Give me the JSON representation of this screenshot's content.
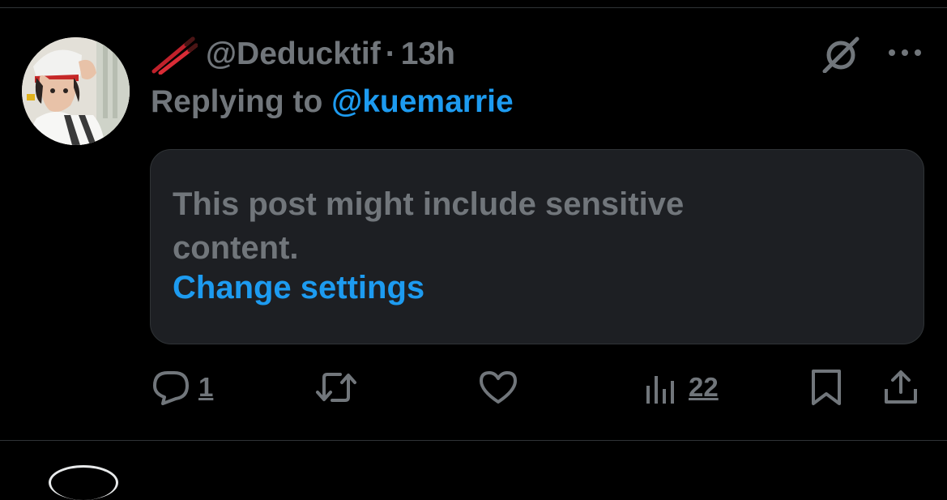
{
  "tweet": {
    "handle": "@Deducktif",
    "separator": "·",
    "time": "13h",
    "replying_prefix": "Replying to ",
    "replying_to": "@kuemarrie",
    "sensitive_notice": "This post might include sensitive content.",
    "change_settings_label": "Change settings"
  },
  "actions": {
    "reply_count": "1",
    "views_count": "22"
  },
  "icons": {
    "name_emoji": "chopsticks-icon",
    "grok": "grok-icon",
    "more": "more-icon",
    "reply": "reply-icon",
    "retweet": "retweet-icon",
    "like": "like-icon",
    "views": "views-icon",
    "bookmark": "bookmark-icon",
    "share": "share-icon"
  },
  "colors": {
    "background": "#000000",
    "secondary_text": "#71767b",
    "accent_blue": "#1d9bf0",
    "card_background": "#1d1f23",
    "border": "#2f3336"
  }
}
